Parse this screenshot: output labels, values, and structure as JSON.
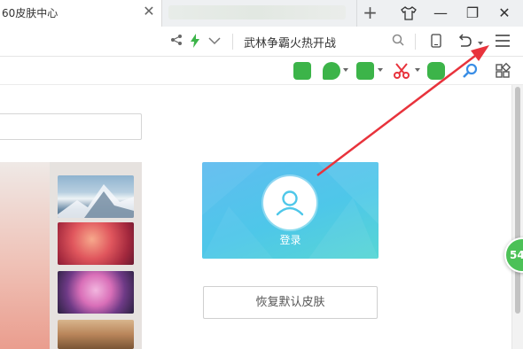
{
  "tab": {
    "title": "60皮肤中心",
    "close_symbol": "✕"
  },
  "window_controls": {
    "new_tab": "+",
    "minimize": "—",
    "restore": "❐",
    "close": "✕"
  },
  "addressbar": {
    "hot_search": "武林争霸火热开战"
  },
  "icons": {
    "share": "share-icon",
    "speed": "lightning-icon",
    "dropdown": "chevron-down-icon",
    "search": "search-icon",
    "mobile": "mobile-icon",
    "undo": "undo-icon",
    "menu": "menu-icon",
    "skin": "tshirt-icon"
  },
  "skins": {
    "login_label": "登录",
    "restore_default": "恢复默认皮肤"
  },
  "float_ball": {
    "value": "54"
  },
  "colors": {
    "accent_green": "#3cb449",
    "login_card": "#4ec7e9",
    "annotation_arrow": "#e8333c"
  }
}
